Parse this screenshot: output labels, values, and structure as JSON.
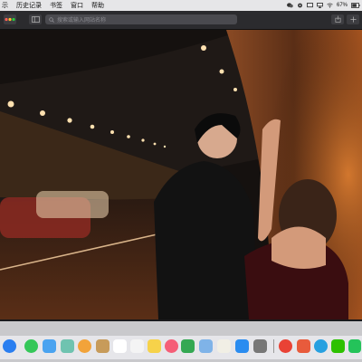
{
  "menubar": {
    "items": [
      "示",
      "历史记录",
      "书签",
      "窗口",
      "帮助"
    ],
    "battery": "67%",
    "icons": [
      "wechat-icon",
      "gear-icon",
      "screen-mirror-icon",
      "airplay-icon",
      "wifi-icon",
      "battery-icon"
    ]
  },
  "toolbar": {
    "sidebar_icon": "sidebar-icon",
    "url_placeholder": "搜索或输入网站名称",
    "share_icon": "share-icon",
    "new_tab_icon": "plus-icon"
  },
  "photo": {
    "subject": "night-tunnel-photo"
  },
  "dock": {
    "icons": [
      "safari-icon",
      "messages-icon",
      "finder-icon",
      "photos-icon",
      "colorsync-icon",
      "notes-icon",
      "calendar-icon",
      "reminders-icon",
      "pages-icon",
      "numbers-icon",
      "music-icon",
      "keynote-icon",
      "preview-icon",
      "app-store-icon",
      "system-preferences-icon",
      "chrome-icon",
      "wps-icon",
      "qq-icon",
      "wechat-icon",
      "messenger-icon"
    ],
    "colors": {
      "safari": "#2a7ef0",
      "messages": "#35c759",
      "finder": "#4aa3f0",
      "photos": "#f2a33a",
      "notes": "#f6d24a",
      "calendar": "#ffffff",
      "music": "#f55e77",
      "appstore": "#2a8cf0",
      "chrome": "#e94235",
      "wechat": "#2dc100"
    }
  }
}
